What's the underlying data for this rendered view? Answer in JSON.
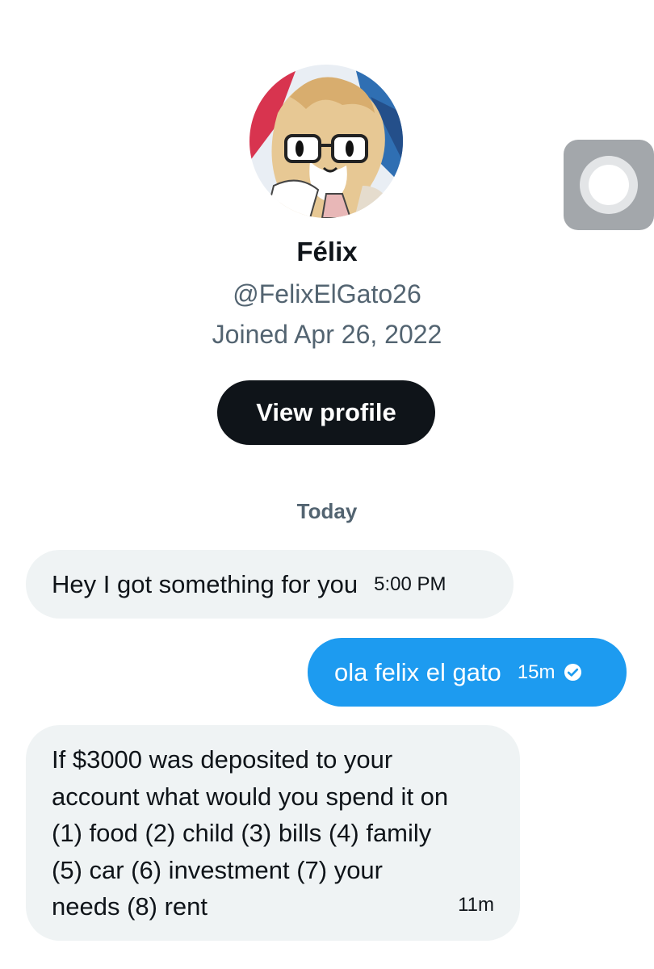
{
  "profile": {
    "name": "Félix",
    "handle": "@FelixElGato26",
    "joined": "Joined Apr 26, 2022",
    "view_profile_label": "View profile"
  },
  "conversation": {
    "date_separator": "Today",
    "messages": [
      {
        "direction": "incoming",
        "text": "Hey I got something for you",
        "time": "5:00 PM"
      },
      {
        "direction": "outgoing",
        "text": "ola felix el gato",
        "time": "15m",
        "status_icon": "check-circle-icon"
      },
      {
        "direction": "incoming",
        "text": "If $3000 was deposited to your account what would you spend it on (1) food (2) child (3) bills (4) family (5) car (6) investment (7) your needs (8) rent",
        "time": "11m"
      }
    ]
  },
  "overlay": {
    "assistive_touch_icon": "assistive-touch-icon"
  },
  "colors": {
    "accent": "#1d9bf0",
    "incoming_bubble": "#eff3f4",
    "primary_text": "#0f1419",
    "secondary_text": "#536471",
    "button_bg": "#0f1419"
  }
}
